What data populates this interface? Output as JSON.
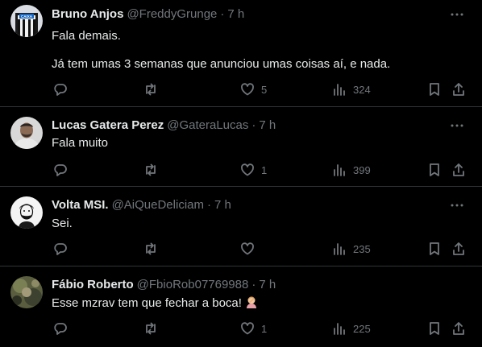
{
  "tweets": [
    {
      "name": "Bruno Anjos",
      "handle": "@FreddyGrunge",
      "sep": "·",
      "time": "7 h",
      "line1": "Fala demais.",
      "line2": "Já tem umas 3 semanas que anunciou umas coisas aí, e nada.",
      "avatar_text": "CAIXA",
      "replies": "",
      "retweets": "",
      "likes": "5",
      "views": "324"
    },
    {
      "name": "Lucas Gatera Perez",
      "handle": "@GateraLucas",
      "sep": "·",
      "time": "7 h",
      "line1": "Fala muito",
      "replies": "",
      "retweets": "",
      "likes": "1",
      "views": "399"
    },
    {
      "name": "Volta MSI.",
      "handle": "@AiQueDeliciam",
      "sep": "·",
      "time": "7 h",
      "line1": "Sei.",
      "replies": "",
      "retweets": "",
      "likes": "",
      "views": "235"
    },
    {
      "name": "Fábio Roberto",
      "handle": "@FbioRob07769988",
      "sep": "·",
      "time": "7 h",
      "line1": "Esse mzrav tem que fechar a boca!",
      "emoji": "person-facepalming",
      "replies": "",
      "retweets": "",
      "likes": "1",
      "views": "225"
    }
  ],
  "colors": {
    "background": "#000000",
    "text": "#e7e9ea",
    "muted": "#71767b",
    "divider": "#2f3336"
  },
  "icons": [
    "reply-icon",
    "retweet-icon",
    "like-icon",
    "views-icon",
    "bookmark-icon",
    "share-icon",
    "more-icon"
  ]
}
